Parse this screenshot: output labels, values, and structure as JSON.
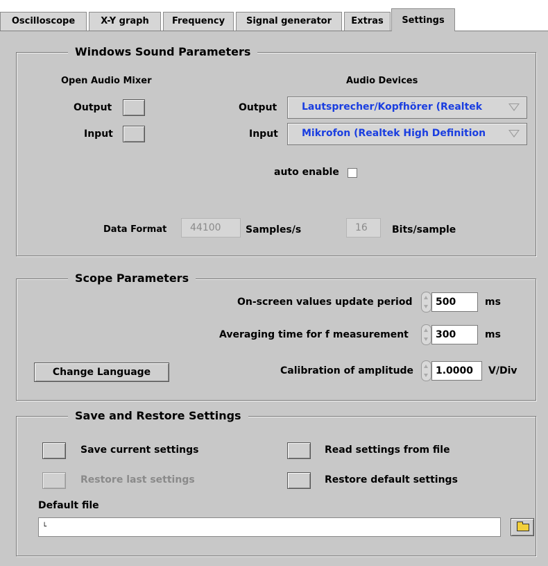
{
  "tabs": [
    {
      "label": "Oscilloscope"
    },
    {
      "label": "X-Y graph"
    },
    {
      "label": "Frequency"
    },
    {
      "label": "Signal generator"
    },
    {
      "label": "Extras"
    },
    {
      "label": "Settings",
      "active": true
    }
  ],
  "sound": {
    "legend": "Windows Sound Parameters",
    "mixer_title": "Open Audio Mixer",
    "mixer_output": "Output",
    "mixer_input": "Input",
    "devices_title": "Audio Devices",
    "device_output_label": "Output",
    "device_output_value": "Lautsprecher/Kopfhörer (Realtek",
    "device_input_label": "Input",
    "device_input_value": "Mikrofon (Realtek High Definition",
    "auto_enable": "auto enable",
    "auto_enable_checked": false,
    "data_format": "Data Format",
    "sample_rate": "44100",
    "sample_rate_unit": "Samples/s",
    "bits": "16",
    "bits_unit": "Bits/sample"
  },
  "scope": {
    "legend": "Scope Parameters",
    "update_period_label": "On-screen values update period",
    "update_period_value": "500",
    "update_period_unit": "ms",
    "averaging_label": "Averaging time for f measurement",
    "averaging_value": "300",
    "averaging_unit": "ms",
    "calibration_label": "Calibration of amplitude",
    "calibration_value": "1.0000",
    "calibration_unit": "V/Div",
    "change_language": "Change Language"
  },
  "save": {
    "legend": "Save and Restore Settings",
    "save_current": "Save current settings",
    "restore_last": "Restore last settings",
    "read_file": "Read settings from file",
    "restore_default": "Restore default settings",
    "default_file_label": "Default file",
    "default_file_value": ""
  },
  "colors": {
    "panel_bg": "#c8c8c8",
    "ring_text": "#1a3ee0",
    "disabled_text": "#8a8a8a"
  }
}
